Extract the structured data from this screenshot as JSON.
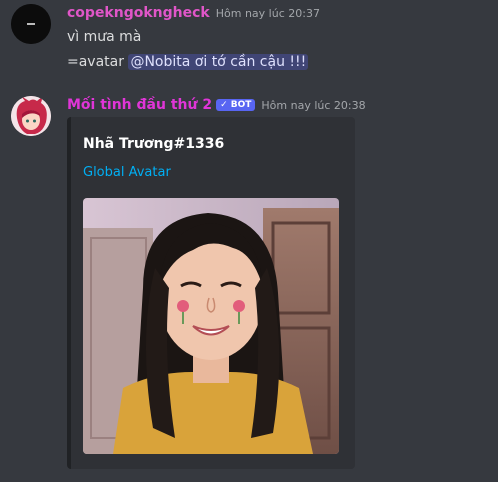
{
  "messages": [
    {
      "username": "copekngokngheck",
      "username_color": "#e056c8",
      "timestamp": "Hôm nay lúc 20:37",
      "lines": [
        "vì mưa mà"
      ],
      "command_prefix": "=avatar",
      "mention": "@Nobita ơi tớ cần cậu !!!"
    },
    {
      "username": "Mối tình đầu thứ 2",
      "username_color": "#e035d8",
      "bot_tag": "✓ BOT",
      "timestamp": "Hôm nay lúc 20:38",
      "embed": {
        "title": "Nhã Trương#1336",
        "link": "Global Avatar"
      }
    }
  ]
}
